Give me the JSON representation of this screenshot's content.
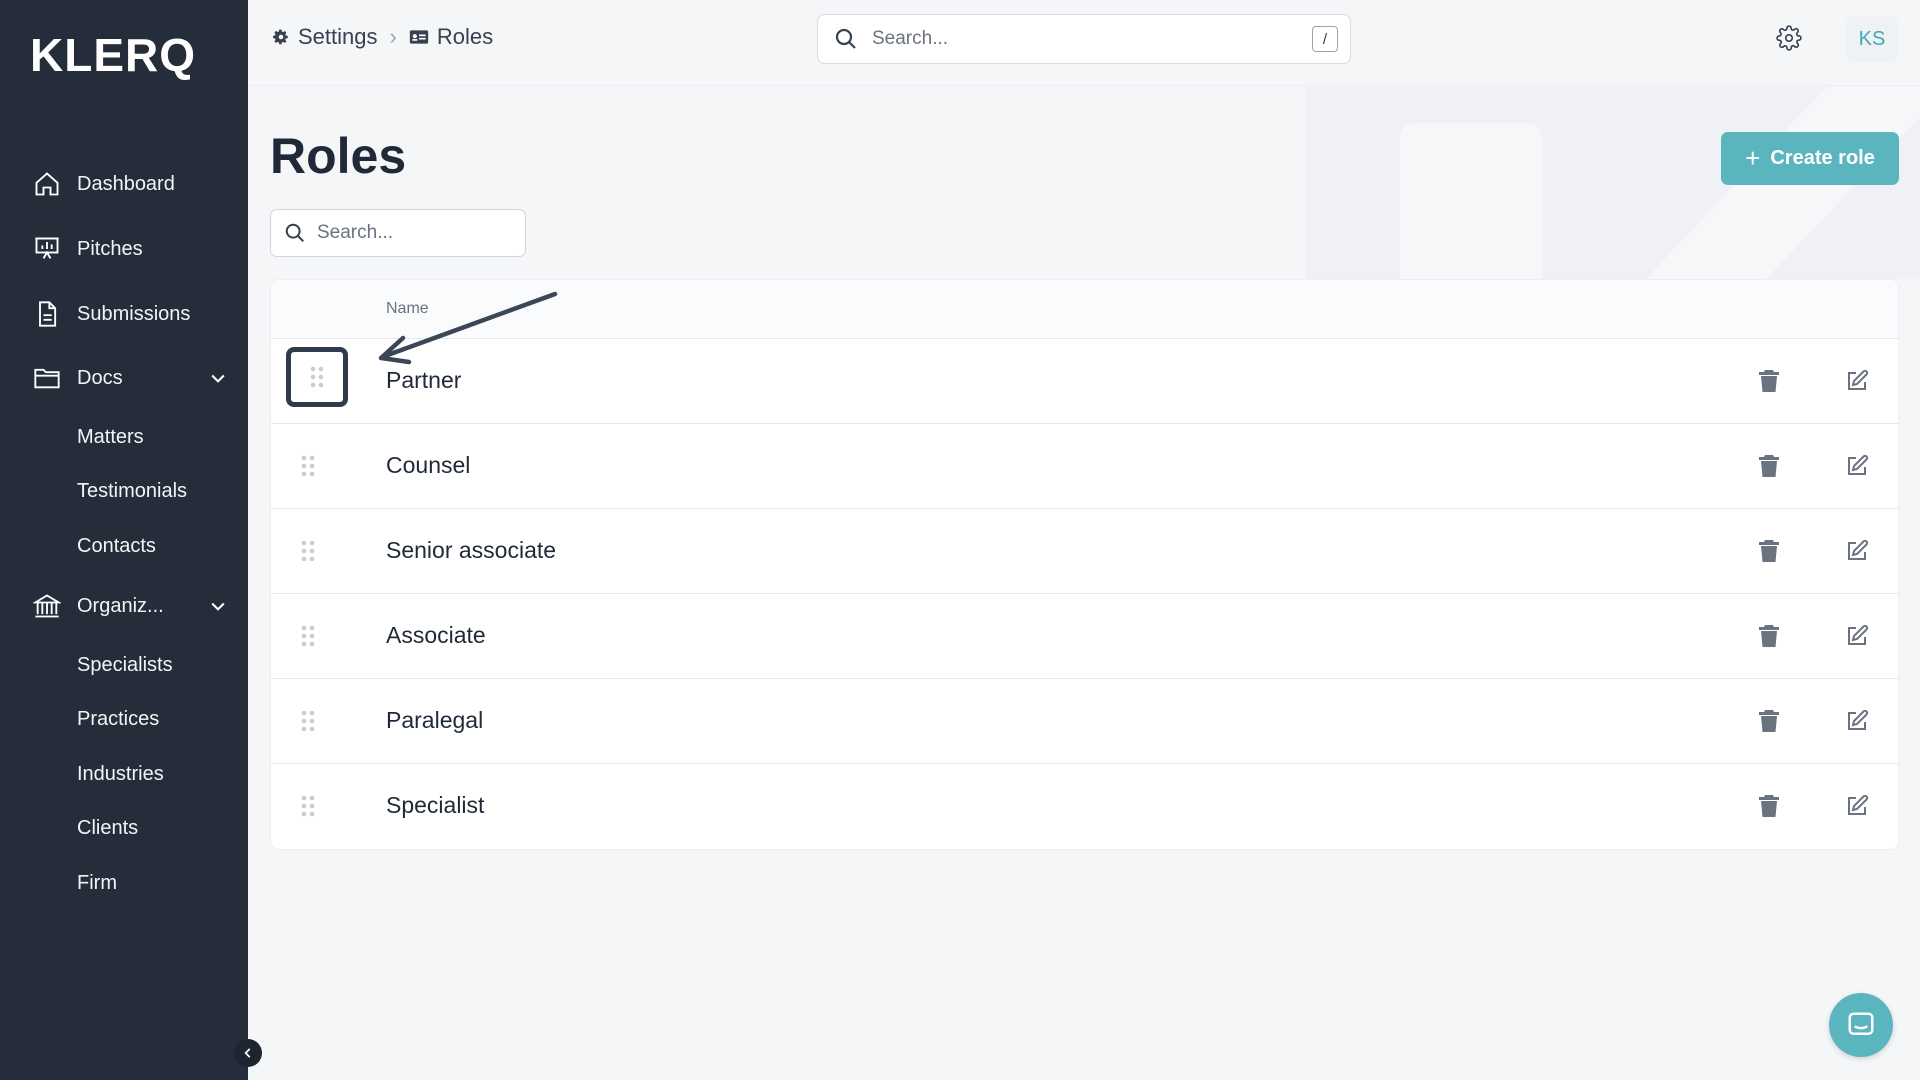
{
  "app": {
    "logo": "KLERQ"
  },
  "sidebar": {
    "items": [
      {
        "label": "Dashboard",
        "icon": "home-icon"
      },
      {
        "label": "Pitches",
        "icon": "presentation-icon"
      },
      {
        "label": "Submissions",
        "icon": "document-icon"
      },
      {
        "label": "Docs",
        "icon": "folder-icon",
        "expanded": true
      },
      {
        "label": "Organiz...",
        "icon": "bank-icon",
        "expanded": true
      }
    ],
    "docs_children": [
      "Matters",
      "Testimonials",
      "Contacts"
    ],
    "org_children": [
      "Specialists",
      "Practices",
      "Industries",
      "Clients",
      "Firm"
    ]
  },
  "header": {
    "breadcrumb": [
      {
        "label": "Settings",
        "icon": "gear-icon"
      },
      {
        "label": "Roles",
        "icon": "id-card-icon"
      }
    ],
    "search": {
      "placeholder": "Search...",
      "shortcut": "/"
    },
    "avatar_initials": "KS"
  },
  "main": {
    "title": "Roles",
    "create_button": "Create role",
    "search_placeholder": "Search...",
    "table": {
      "columns": [
        "Name"
      ],
      "rows": [
        "Partner",
        "Counsel",
        "Senior associate",
        "Associate",
        "Paralegal",
        "Specialist"
      ]
    }
  },
  "colors": {
    "sidebar_bg": "#252d3a",
    "accent": "#5bb5bf",
    "background": "#f5f6f8"
  }
}
